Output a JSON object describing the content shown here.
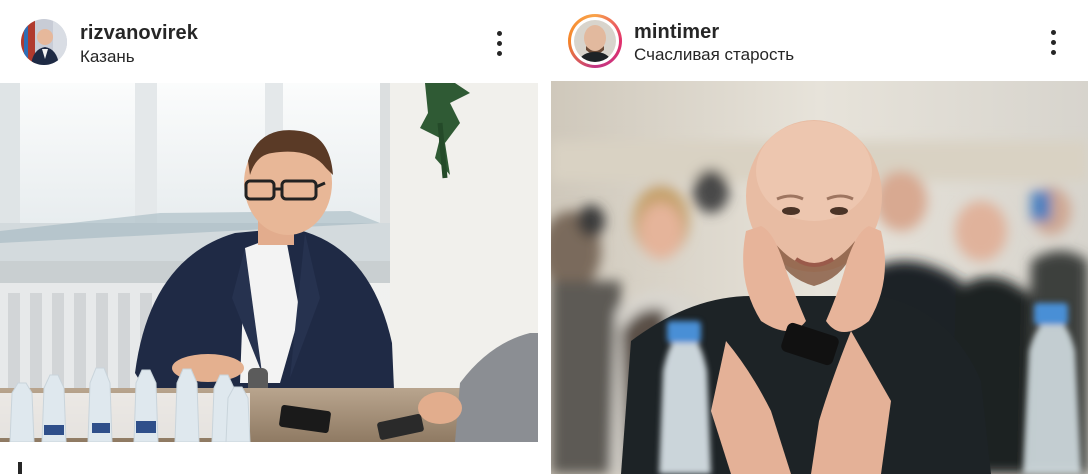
{
  "posts": [
    {
      "username": "rizvanovirek",
      "location": "Казань",
      "more_icon": "more-options-icon"
    },
    {
      "username": "mintimer",
      "location": "Счасливая старость",
      "more_icon": "more-options-icon"
    }
  ]
}
